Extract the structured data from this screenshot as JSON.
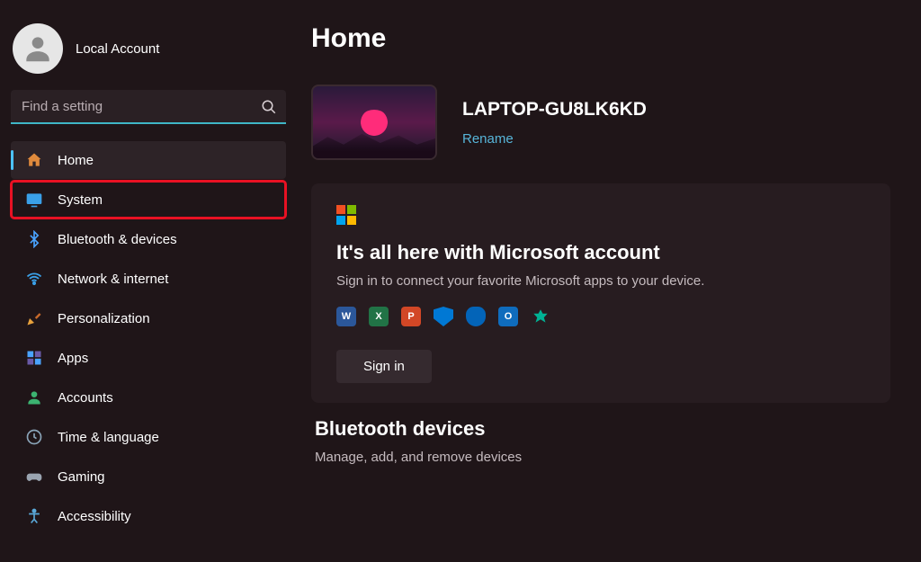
{
  "account": {
    "name": "Local Account"
  },
  "search": {
    "placeholder": "Find a setting"
  },
  "nav": {
    "items": [
      {
        "label": "Home",
        "icon": "home-icon"
      },
      {
        "label": "System",
        "icon": "system-icon"
      },
      {
        "label": "Bluetooth & devices",
        "icon": "bluetooth-icon"
      },
      {
        "label": "Network & internet",
        "icon": "wifi-icon"
      },
      {
        "label": "Personalization",
        "icon": "personalization-icon"
      },
      {
        "label": "Apps",
        "icon": "apps-icon"
      },
      {
        "label": "Accounts",
        "icon": "accounts-icon"
      },
      {
        "label": "Time & language",
        "icon": "time-language-icon"
      },
      {
        "label": "Gaming",
        "icon": "gaming-icon"
      },
      {
        "label": "Accessibility",
        "icon": "accessibility-icon"
      }
    ],
    "selected": 0,
    "highlighted": 1
  },
  "page": {
    "title": "Home",
    "device": {
      "name": "LAPTOP-GU8LK6KD",
      "rename_label": "Rename"
    },
    "ms_card": {
      "title": "It's all here with Microsoft account",
      "subtitle": "Sign in to connect your favorite Microsoft apps to your device.",
      "signin_label": "Sign in",
      "apps": [
        {
          "name": "word-icon",
          "letter": "W",
          "color": "#2b579a"
        },
        {
          "name": "excel-icon",
          "letter": "X",
          "color": "#217346"
        },
        {
          "name": "powerpoint-icon",
          "letter": "P",
          "color": "#d24726"
        },
        {
          "name": "security-icon",
          "letter": "",
          "color": "#0078d4"
        },
        {
          "name": "onedrive-icon",
          "letter": "",
          "color": "#0364b8"
        },
        {
          "name": "outlook-icon",
          "letter": "O",
          "color": "#0f6cbd"
        },
        {
          "name": "family-icon",
          "letter": "",
          "color": "#00b294"
        }
      ]
    },
    "bluetooth": {
      "title": "Bluetooth devices",
      "subtitle": "Manage, add, and remove devices"
    }
  }
}
